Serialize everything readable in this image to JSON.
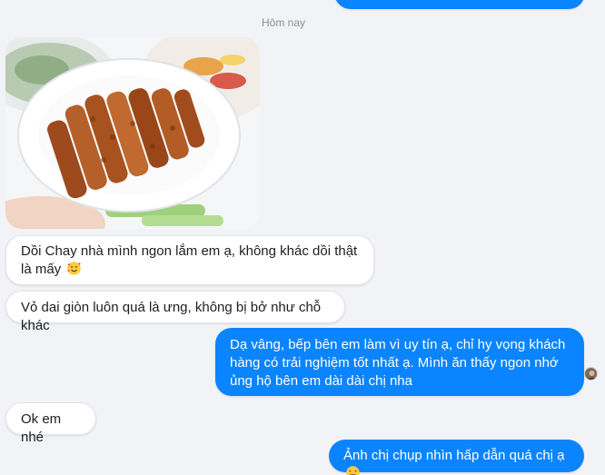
{
  "colors": {
    "background": "#f2f3f6",
    "incoming_bubble": "#ffffff",
    "outgoing_bubble": "#0a84ff",
    "date_text": "#8a8d91"
  },
  "chat": {
    "date_separator": "Hôm nay",
    "messages": [
      {
        "side": "incoming",
        "type": "image",
        "icon": "food-photo"
      },
      {
        "side": "incoming",
        "text": "Dồi Chay nhà mình ngon lắm em ạ, không khác dồi thật là mấy",
        "emoji": "smiling-face-with-hearts-icon"
      },
      {
        "side": "incoming",
        "text": "Vỏ dai giòn luôn quá là ưng, không bị bở như chỗ khác"
      },
      {
        "side": "outgoing",
        "text": "Dạ vâng, bếp bên em làm vì uy tín ạ, chỉ hy vọng khách hàng có trải nghiệm tốt nhất ạ. Mình ăn thấy ngon nhớ ủng hộ bên em dài dài chị nha"
      },
      {
        "side": "incoming",
        "text": "Ok em nhé"
      },
      {
        "side": "outgoing",
        "text": "Ảnh chị chụp nhìn hấp dẫn quá chị ạ",
        "emoji": "smiling-face-with-heart-eyes-icon"
      }
    ]
  }
}
